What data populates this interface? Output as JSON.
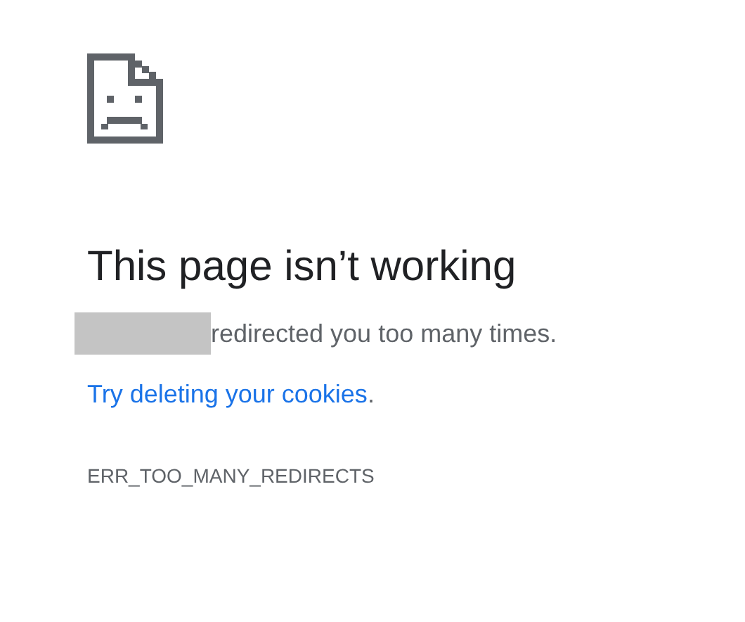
{
  "error_page": {
    "title": "This page isn’t working",
    "host_redacted": true,
    "message": "redirected you too many times.",
    "link": "Try deleting your cookies",
    "link_suffix": ".",
    "error_code": "ERR_TOO_MANY_REDIRECTS"
  }
}
